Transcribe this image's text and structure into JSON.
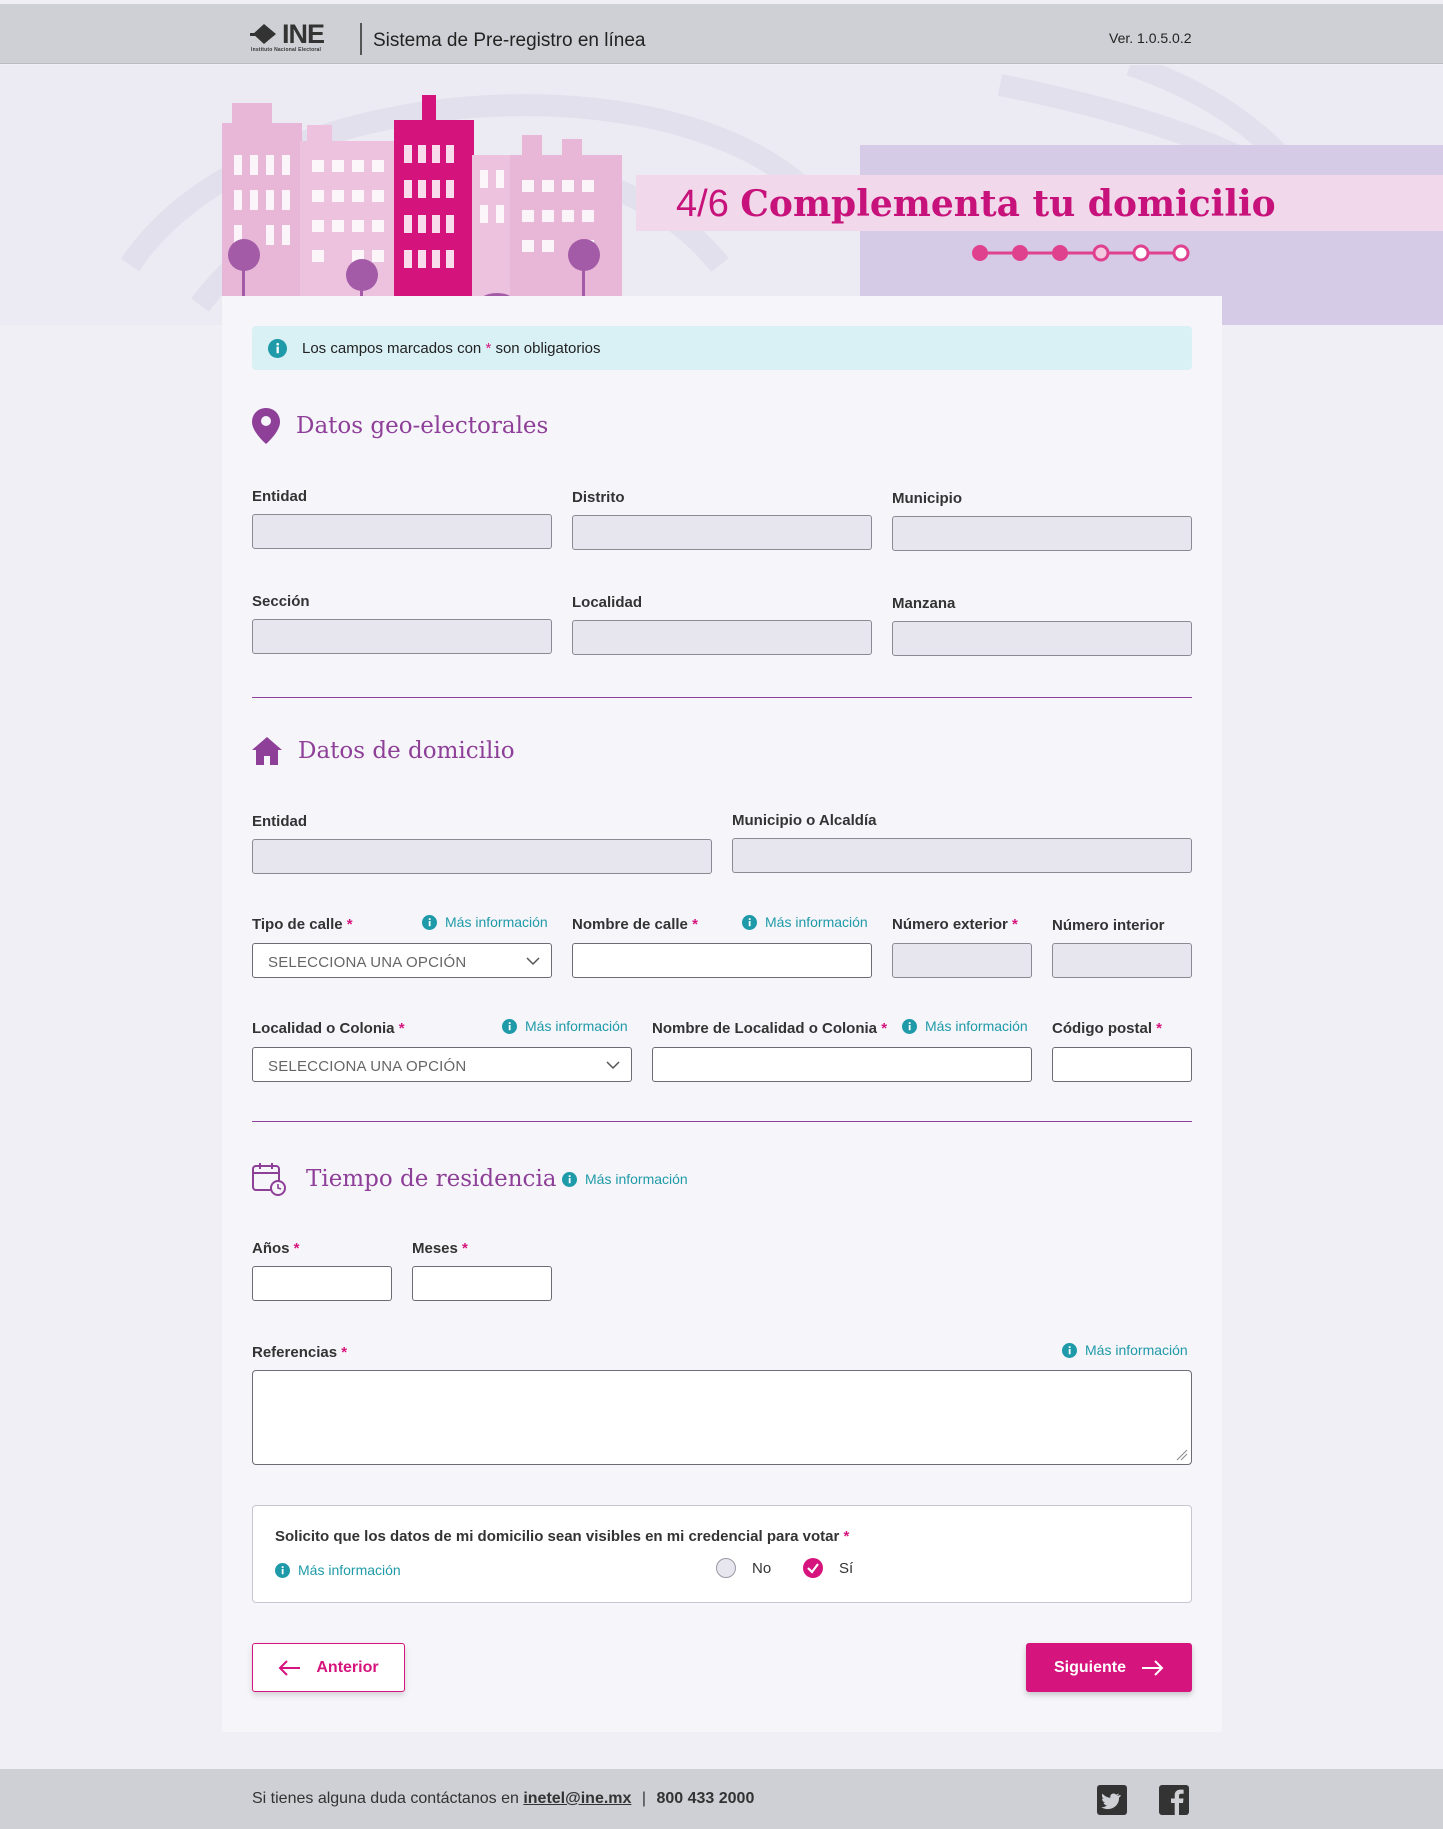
{
  "header": {
    "logo_text": "INE",
    "logo_subtitle": "Instituto Nacional Electoral",
    "app_title": "Sistema de Pre-registro en línea",
    "version": "Ver. 1.0.5.0.2"
  },
  "step": {
    "number": "4/6",
    "title": "Complementa tu domicilio",
    "completed": 3,
    "total": 6
  },
  "notice": {
    "text_before": "Los campos marcados con",
    "asterisk": "*",
    "text_after": "son obligatorios"
  },
  "geo": {
    "title": "Datos geo-electorales",
    "fields": {
      "entidad": "Entidad",
      "distrito": "Distrito",
      "municipio": "Municipio",
      "seccion": "Sección",
      "localidad": "Localidad",
      "manzana": "Manzana"
    }
  },
  "domicilio": {
    "title": "Datos de domicilio",
    "entidad": "Entidad",
    "municipio": "Municipio o Alcaldía",
    "tipo_calle": "Tipo de calle",
    "nombre_calle": "Nombre de calle",
    "num_ext": "Número exterior",
    "num_int": "Número interior",
    "localidad_colonia": "Localidad o Colonia",
    "nombre_localidad": "Nombre de Localidad o Colonia",
    "codigo_postal": "Código postal",
    "select_placeholder": "SELECCIONA UNA OPCIÓN"
  },
  "residencia": {
    "title": "Tiempo de residencia",
    "anios": "Años",
    "meses": "Meses",
    "referencias": "Referencias"
  },
  "more_info": "Más información",
  "required_mark": "*",
  "visible": {
    "question": "Solicito que los datos de mi domicilio sean visibles en mi credencial para votar",
    "option_no": "No",
    "option_si": "Sí",
    "selected": "Sí"
  },
  "buttons": {
    "prev": "Anterior",
    "next": "Siguiente"
  },
  "footer": {
    "text": "Si tienes alguna duda contáctanos en",
    "email": "inetel@ine.mx",
    "separator": "|",
    "phone": "800 433 2000"
  },
  "colors": {
    "accent": "#d6147d",
    "section": "#8e3f98",
    "info": "#1f9aa8"
  }
}
